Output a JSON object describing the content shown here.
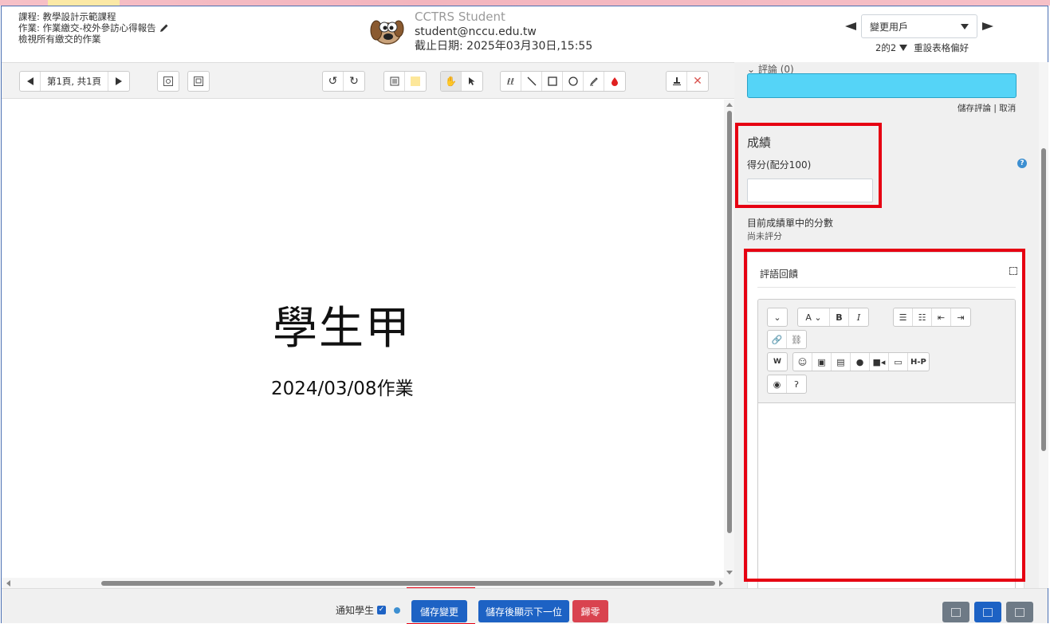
{
  "header": {
    "course_line": "課程: 教學設計示範課程",
    "assignment_line": "作業: 作業繳交-校外參訪心得報告",
    "view_all": "檢視所有繳交的作業",
    "student_name": "CCTRS Student",
    "student_email": "student@nccu.edu.tw",
    "due_date": "截止日期:  2025年03月30日,15:55",
    "change_user": "變更用戶",
    "user_count": "2的2",
    "reset_table": "重設表格偏好"
  },
  "toolbar": {
    "page_label": "第1頁, 共1頁"
  },
  "document": {
    "title": "學生甲",
    "subtitle": "2024/03/08作業"
  },
  "panel": {
    "comments_label": "評論 (0)",
    "save_comment": "儲存評論",
    "cancel": "取消",
    "grade_section": "成績",
    "score_label": "得分(配分100)",
    "score_value": "",
    "current_grade_label": "目前成績單中的分數",
    "current_grade_value": "尚未評分",
    "feedback_title": "評語回饋"
  },
  "footer": {
    "notify_label": "通知學生",
    "notify_checked": true,
    "save_changes": "儲存變更",
    "save_next": "儲存後顯示下一位",
    "reset": "歸零"
  },
  "colors": {
    "primary": "#1d62c4",
    "danger": "#d9434f",
    "comment_box": "#55d4f7",
    "highlight": "#e60012"
  }
}
